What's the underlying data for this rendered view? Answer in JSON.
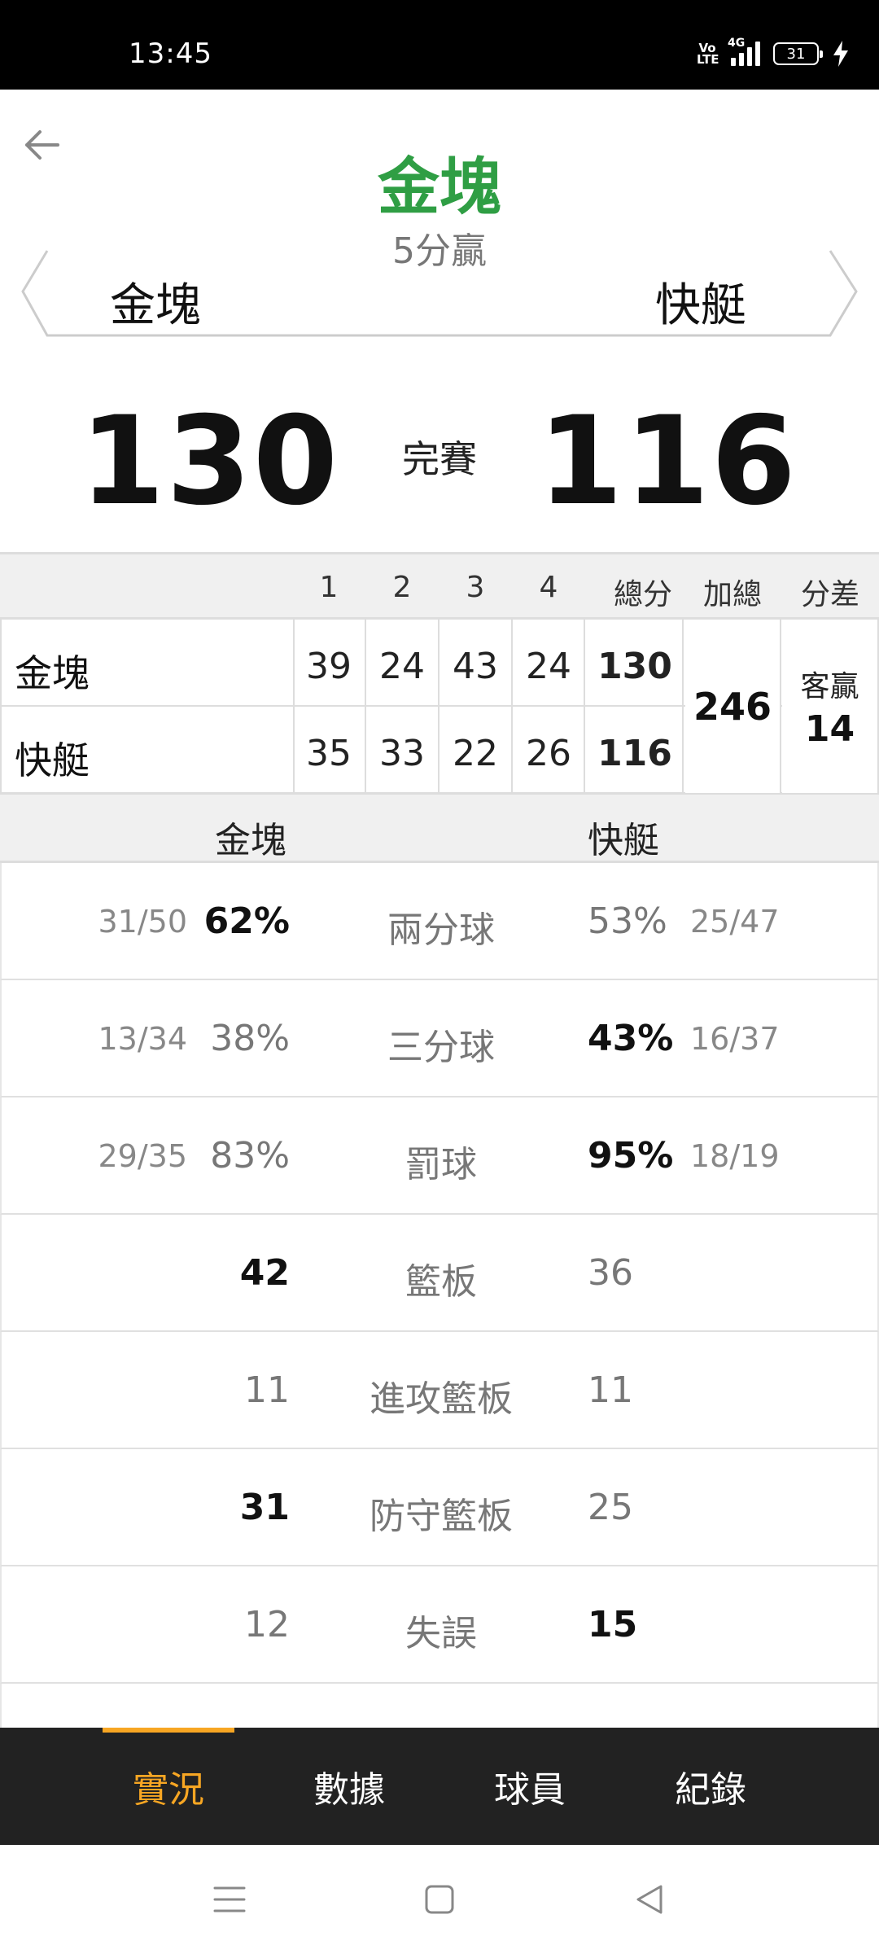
{
  "status_bar": {
    "time": "13:45",
    "volte": "Vo LTE",
    "network": "4G",
    "battery": "31"
  },
  "header": {
    "winner": "金塊",
    "margin_text": "5分贏"
  },
  "teams": {
    "left": "金塊",
    "right": "快艇"
  },
  "score": {
    "left": "130",
    "right": "116",
    "status": "完賽"
  },
  "quarter_table": {
    "headers": [
      "1",
      "2",
      "3",
      "4",
      "總分",
      "加總",
      "分差"
    ],
    "rows": [
      {
        "team": "金塊",
        "q": [
          "39",
          "24",
          "43",
          "24"
        ],
        "total": "130"
      },
      {
        "team": "快艇",
        "q": [
          "35",
          "33",
          "22",
          "26"
        ],
        "total": "116"
      }
    ],
    "sum": "246",
    "diff_label": "客贏",
    "diff_value": "14"
  },
  "stats_header": {
    "left": "金塊",
    "right": "快艇"
  },
  "stats": [
    {
      "lfrac": "31/50",
      "lval": "62%",
      "label": "兩分球",
      "rval": "53%",
      "rfrac": "25/47"
    },
    {
      "lfrac": "13/34",
      "lval": "38%",
      "label": "三分球",
      "rval": "43%",
      "rfrac": "16/37"
    },
    {
      "lfrac": "29/35",
      "lval": "83%",
      "label": "罰球",
      "rval": "95%",
      "rfrac": "18/19"
    },
    {
      "lfrac": "",
      "lval": "42",
      "label": "籃板",
      "rval": "36",
      "rfrac": ""
    },
    {
      "lfrac": "",
      "lval": "11",
      "label": "進攻籃板",
      "rval": "11",
      "rfrac": ""
    },
    {
      "lfrac": "",
      "lval": "31",
      "label": "防守籃板",
      "rval": "25",
      "rfrac": ""
    },
    {
      "lfrac": "",
      "lval": "12",
      "label": "失誤",
      "rval": "15",
      "rfrac": ""
    }
  ],
  "tabs": [
    "實況",
    "數據",
    "球員",
    "紀錄"
  ],
  "active_tab": "實況",
  "colors": {
    "winner": "#2f9e44",
    "accent": "#f7a623",
    "tab_bar": "#222222"
  },
  "icons": {
    "back": "arrow-left-icon",
    "nav_menu": "menu-icon",
    "nav_home": "square-home-icon",
    "nav_back": "triangle-back-icon"
  }
}
